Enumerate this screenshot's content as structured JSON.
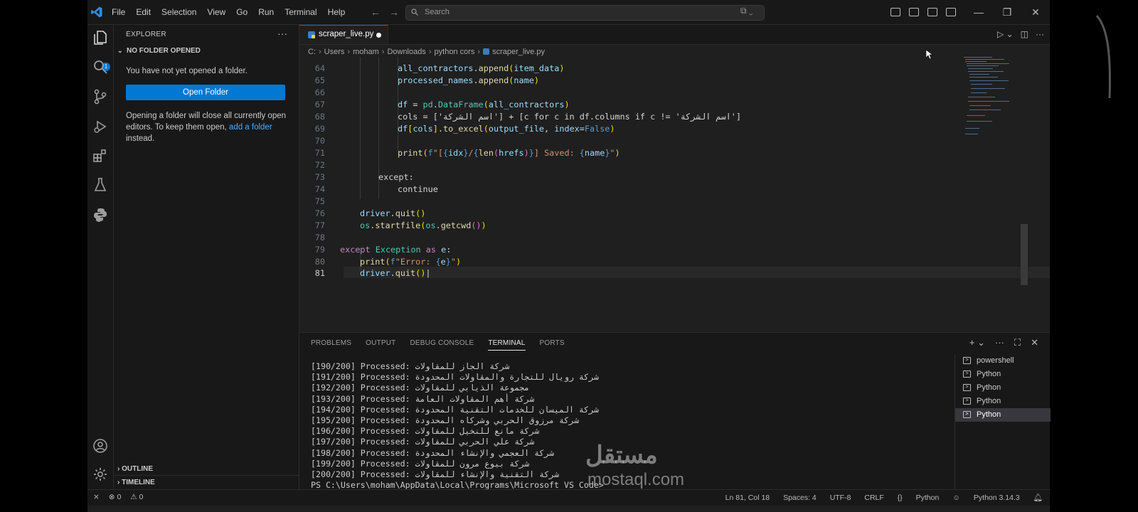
{
  "menu": [
    "File",
    "Edit",
    "Selection",
    "View",
    "Go",
    "Run",
    "Terminal",
    "Help"
  ],
  "search": {
    "placeholder": "Search"
  },
  "explorer": {
    "title": "EXPLORER",
    "section": "NO FOLDER OPENED",
    "message": "You have not yet opened a folder.",
    "open_folder": "Open Folder",
    "note_part1": "Opening a folder will close all currently open editors. To keep them open, ",
    "note_link": "add a folder",
    "note_part2": " instead.",
    "outline": "OUTLINE",
    "timeline": "TIMELINE",
    "badge": "1"
  },
  "tab": {
    "name": "scraper_live.py"
  },
  "breadcrumb": [
    "C:",
    "Users",
    "moham",
    "Downloads",
    "python cors",
    "scraper_live.py"
  ],
  "code_lines": [
    {
      "n": "64"
    },
    {
      "n": "65"
    },
    {
      "n": "66"
    },
    {
      "n": "67"
    },
    {
      "n": "68"
    },
    {
      "n": "69"
    },
    {
      "n": "70"
    },
    {
      "n": "71"
    },
    {
      "n": "72"
    },
    {
      "n": "73"
    },
    {
      "n": "74"
    },
    {
      "n": "75"
    },
    {
      "n": "76"
    },
    {
      "n": "77"
    },
    {
      "n": "78"
    },
    {
      "n": "79"
    },
    {
      "n": "80"
    },
    {
      "n": "81"
    }
  ],
  "code_text": {
    "l64": "all_contractors.append(item_data)",
    "l65": "processed_names.append(name)",
    "l67": "df = pd.DataFrame(all_contractors)",
    "l68": "cols = ['اسم الشركة'] + [c for c in df.columns if c != 'اسم الشركة']",
    "l69": "df[cols].to_excel(output_file, index=False)",
    "l71": "print(f\"[{idx}/{len(hrefs)}] Saved: {name}\")",
    "l73": "except:",
    "l74": "continue",
    "l76": "driver.quit()",
    "l77": "os.startfile(os.getcwd())",
    "l79": "except Exception as e:",
    "l80": "print(f\"Error: {e}\")",
    "l81": "driver.quit()"
  },
  "panel": {
    "tabs": [
      "PROBLEMS",
      "OUTPUT",
      "DEBUG CONSOLE",
      "TERMINAL",
      "PORTS"
    ],
    "active_tab": "TERMINAL",
    "terminal_lines": [
      "[190/200] Processed: شركة الجاز للمقاولات",
      "[191/200] Processed: شركة رويال للتجارة والمقاولات المحدودة",
      "[192/200] Processed: مجموعة الذيابي للمقاولات",
      "[193/200] Processed: شركة أهم المقاولات العامة",
      "[194/200] Processed: شركة الميسان للخدمات التقنية المحدودة",
      "[195/200] Processed: شركة مرزوق الحربي وشركاه المحدودة",
      "[196/200] Processed: شركة مانع للنخيل للمقاولات",
      "[197/200] Processed: شركة علي الحربي للمقاولات",
      "[198/200] Processed: شركة العجمي والإنشاء المحدودة",
      "[199/200] Processed: شركة بيوع مرون للمقاولات",
      "[200/200] Processed: شركة التقنية والإنشاء للمقاولات",
      "PS C:\\Users\\moham\\AppData\\Local\\Programs\\Microsoft VS Code> "
    ],
    "terminals": [
      "powershell",
      "Python",
      "Python",
      "Python",
      "Python"
    ]
  },
  "status": {
    "errors": "0",
    "warnings": "0",
    "position": "Ln 81, Col 18",
    "spaces": "Spaces: 4",
    "encoding": "UTF-8",
    "eol": "CRLF",
    "language": "Python",
    "interpreter": "Python 3.14.3"
  },
  "watermark": {
    "arabic": "مستقل",
    "latin": "mostaql.com"
  },
  "colors": {
    "accent": "#0078d4",
    "bg": "#1f1f1f",
    "sidebar": "#181818"
  }
}
